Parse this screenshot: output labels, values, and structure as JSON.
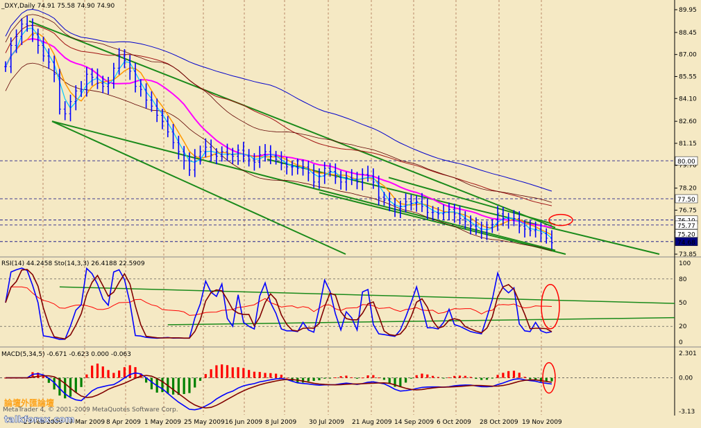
{
  "colors": {
    "background": "#f5e9c4",
    "axis_panel_bg": "#ffffff",
    "grid_line": "#a06040",
    "price_bar": "#0000ff",
    "channel": "#1a8a1a",
    "ma_magenta": "#ff00ff",
    "ma_orange": "#ff9900",
    "ma_cyan": "#00c8ff",
    "ma_blue": "#0000ff",
    "ma_darkred": "#a01010",
    "envelope": "#600000",
    "rsi_red": "#ff0000",
    "stoch_blue": "#0000ff",
    "stoch_dark": "#800000",
    "hist_pos": "#ff0000",
    "hist_neg": "#008000",
    "ellipse": "#ff0000",
    "price_tag": "#000080"
  },
  "header": {
    "price_title": "_DXY,Daily  74.91 75.58 74.90 74.90",
    "rsi_title": "RSI(14) 44.2458  Sto(14,3,3) 26.4188 22.5909",
    "macd_title": "MACD(5,34,5) -0.671 -0.623 0.000 -0.063"
  },
  "chart_data": [
    {
      "type": "candlestick",
      "panel": "price",
      "title": "_DXY,Daily 74.91 75.58 74.90 74.90",
      "series_name": "_DXY",
      "ohlc_last": {
        "open": 74.91,
        "high": 75.58,
        "low": 74.9,
        "close": 74.9
      },
      "y_ticks": [
        "89.95",
        "88.45",
        "87.00",
        "85.55",
        "84.10",
        "82.60",
        "81.15",
        "79.70",
        "78.20",
        "76.75",
        "75.30",
        "73.85"
      ],
      "ylim": [
        73.85,
        89.95
      ],
      "horizontal_levels": [
        80.0,
        77.5,
        76.1,
        75.77,
        74.68
      ],
      "price_tags": [
        {
          "label": "80.00",
          "value": 80.0,
          "fill": "#ffffff",
          "text": "#000000"
        },
        {
          "label": "77.50",
          "value": 77.5,
          "fill": "#ffffff",
          "text": "#000000"
        },
        {
          "label": "76.10",
          "value": 76.1,
          "fill": "#ffffff",
          "text": "#000000"
        },
        {
          "label": "75.77",
          "value": 75.77,
          "fill": "#ffffff",
          "text": "#000000"
        },
        {
          "label": "75.20",
          "value": 75.2,
          "fill": "#ffffff",
          "text": "#000000"
        },
        {
          "label": "74.68",
          "value": 74.68,
          "fill": "#000080",
          "text": "#ffffff"
        }
      ],
      "x_labels": [
        "23 Feb 2009",
        "17 Mar 2009",
        "8 Apr 2009",
        "1 May 2009",
        "25 May 2009",
        "16 Jun 2009",
        "8 Jul 2009",
        "30 Jul 2009",
        "21 Aug 2009",
        "14 Sep 2009",
        "6 Oct 2009",
        "28 Oct 2009",
        "19 Nov 2009"
      ],
      "closes": [
        86.2,
        87.6,
        88.2,
        89.0,
        88.9,
        88.3,
        87.6,
        86.9,
        86.5,
        85.7,
        83.4,
        83.1,
        83.9,
        84.6,
        84.7,
        85.7,
        85.5,
        85.1,
        84.9,
        85.1,
        86.1,
        86.9,
        86.6,
        85.9,
        84.9,
        84.7,
        84.0,
        83.6,
        83.0,
        82.6,
        81.9,
        81.2,
        80.6,
        80.0,
        79.4,
        80.3,
        80.6,
        80.9,
        80.4,
        80.3,
        80.6,
        80.4,
        80.3,
        80.7,
        80.3,
        80.1,
        79.9,
        80.4,
        80.6,
        80.3,
        80.1,
        79.8,
        79.6,
        79.6,
        79.5,
        79.6,
        79.2,
        78.6,
        79.0,
        79.5,
        79.3,
        78.9,
        78.6,
        78.9,
        78.8,
        78.6,
        79.1,
        79.0,
        78.6,
        77.6,
        77.4,
        77.1,
        76.8,
        77.0,
        77.3,
        77.2,
        77.3,
        77.0,
        76.6,
        76.6,
        76.5,
        76.6,
        76.8,
        76.5,
        76.2,
        76.0,
        75.7,
        75.5,
        75.3,
        75.6,
        75.8,
        76.5,
        76.2,
        76.1,
        76.2,
        75.7,
        75.5,
        75.4,
        75.5,
        75.2,
        74.9,
        74.6
      ]
    },
    {
      "type": "line",
      "panel": "oscillator",
      "title": "RSI(14) 44.2458 Sto(14,3,3) 26.4188 22.5909",
      "y_ticks": [
        "100",
        "80",
        "50",
        "20",
        "0"
      ],
      "ylim": [
        0,
        100
      ],
      "series": [
        {
          "name": "RSI(14)",
          "last": 44.2458
        },
        {
          "name": "Sto(14,3,3)",
          "last": 26.4188,
          "signal_last": 22.5909
        }
      ],
      "guide_levels": [
        80,
        20
      ]
    },
    {
      "type": "bar",
      "panel": "macd",
      "title": "MACD(5,34,5) -0.671 -0.623 0.000 -0.063",
      "y_ticks": [
        "2.301",
        "0.00",
        "-3.13"
      ],
      "ylim": [
        -3.13,
        2.301
      ],
      "series": [
        {
          "name": "MACD(5,34,5)",
          "values_last": [
            -0.671,
            -0.623,
            0.0,
            -0.063
          ]
        }
      ]
    }
  ],
  "watermark": {
    "line1": "MetaTrader 4, © 2001-2009 MetaQuotes Software Corp.",
    "site": "talkforex.com",
    "badge": "論壇外匯論壇"
  }
}
